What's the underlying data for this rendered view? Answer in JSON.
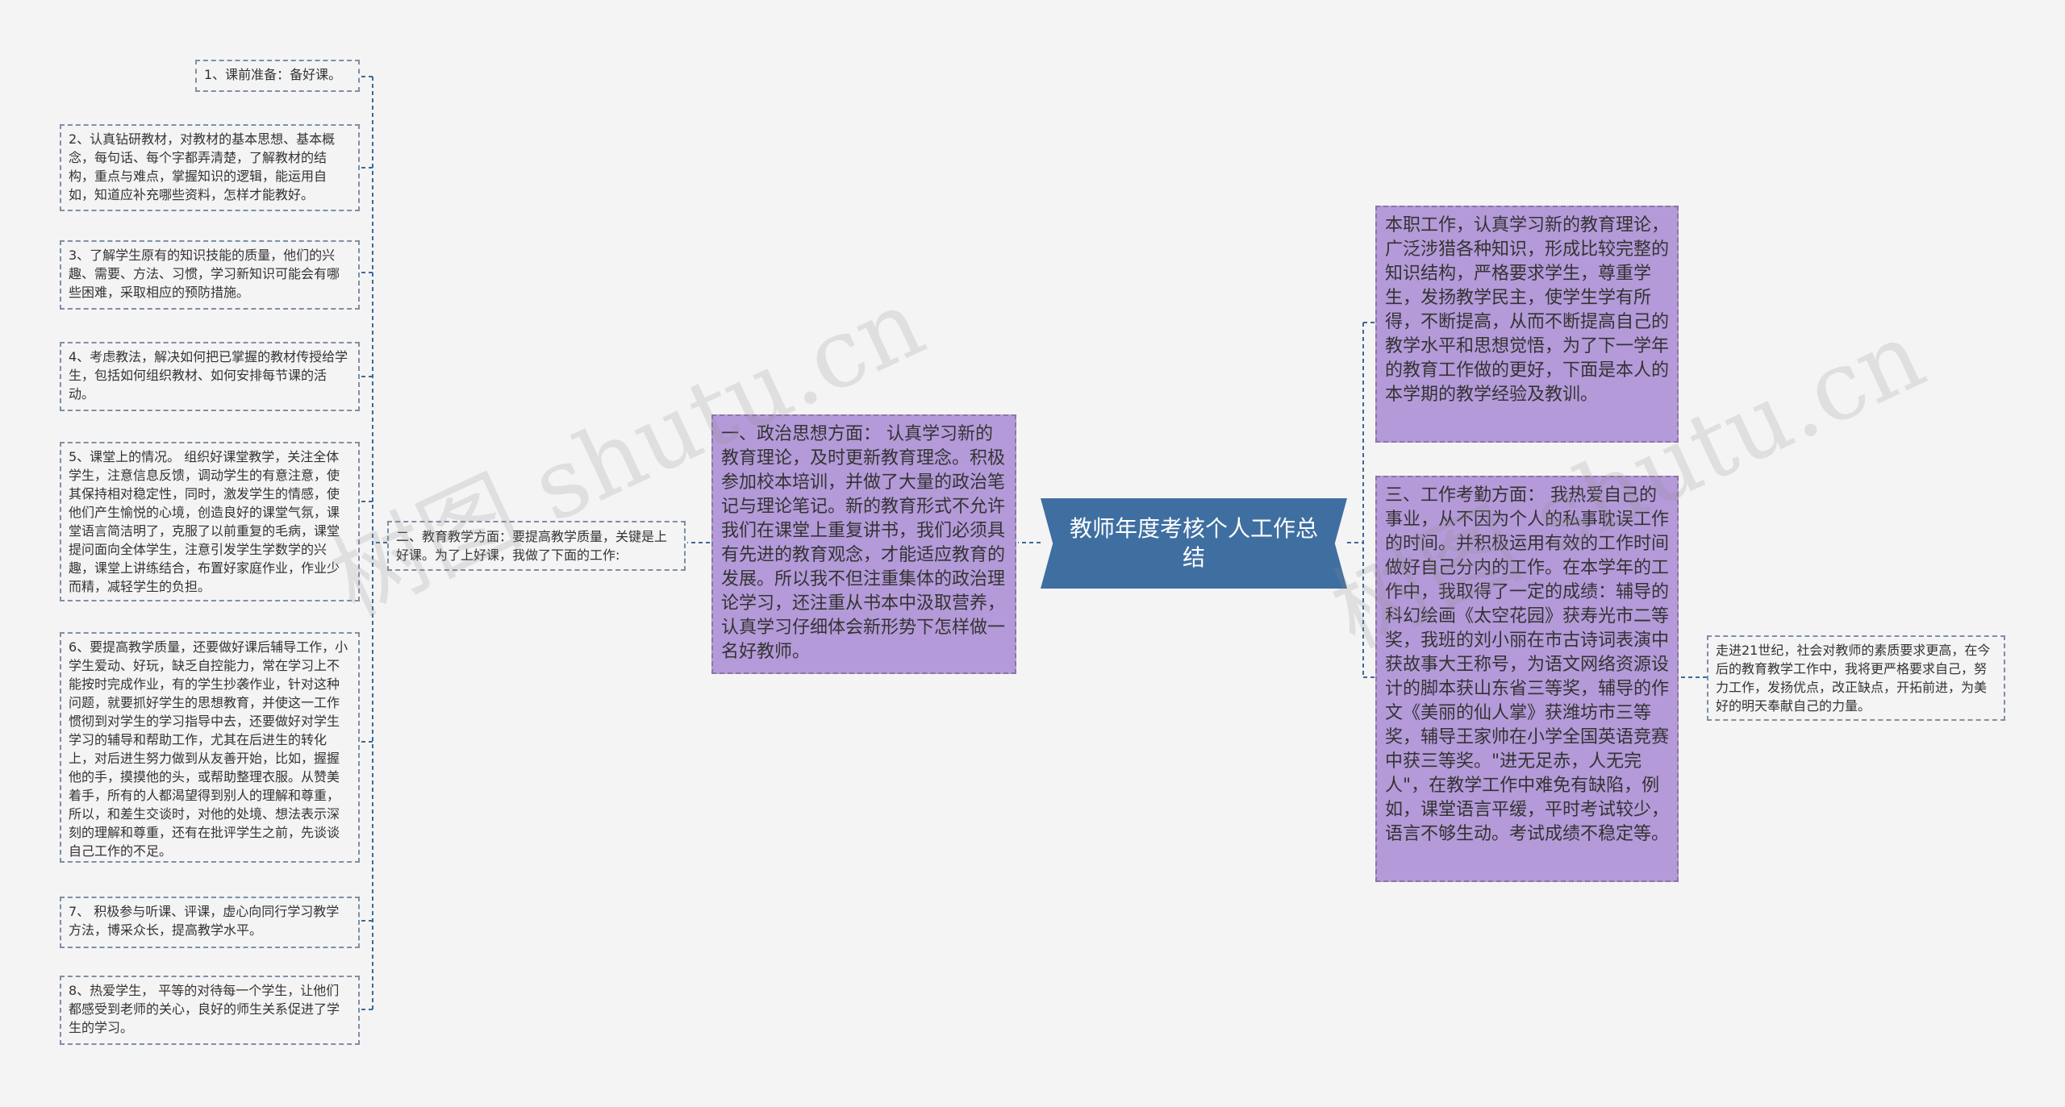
{
  "root": {
    "title": "教师年度考核个人工作总结"
  },
  "left_main": {
    "text": "一、政治思想方面： 认真学习新的教育理论，及时更新教育理念。积极参加校本培训，并做了大量的政治笔记与理论笔记。新的教育形式不允许我们在课堂上重复讲书，我们必须具有先进的教育观念，才能适应教育的发展。所以我不但注重集体的政治理论学习，还注重从书本中汲取营养，认真学习仔细体会新形势下怎样做一名好教师。"
  },
  "left_sub": {
    "text": "二、教育教学方面：要提高教学质量，关键是上好课。为了上好课，我做了下面的工作:"
  },
  "leaves": [
    {
      "text": "1、课前准备：备好课。"
    },
    {
      "text": "2、认真钻研教材，对教材的基本思想、基本概念，每句话、每个字都弄清楚，了解教材的结构，重点与难点，掌握知识的逻辑，能运用自如，知道应补充哪些资料，怎样才能教好。"
    },
    {
      "text": "3、了解学生原有的知识技能的质量，他们的兴趣、需要、方法、习惯，学习新知识可能会有哪些困难，采取相应的预防措施。"
    },
    {
      "text": "4、考虑教法，解决如何把已掌握的教材传授给学生，包括如何组织教材、如何安排每节课的活动。"
    },
    {
      "text": "5、课堂上的情况。 组织好课堂教学，关注全体学生，注意信息反馈，调动学生的有意注意，使其保持相对稳定性，同时，激发学生的情感，使他们产生愉悦的心境，创造良好的课堂气氛，课堂语言简洁明了，克服了以前重复的毛病，课堂提问面向全体学生，注意引发学生学数学的兴趣，课堂上讲练结合，布置好家庭作业，作业少而精，减轻学生的负担。"
    },
    {
      "text": "6、要提高教学质量，还要做好课后辅导工作，小学生爱动、好玩，缺乏自控能力，常在学习上不能按时完成作业，有的学生抄袭作业，针对这种问题，就要抓好学生的思想教育，并使这一工作惯彻到对学生的学习指导中去，还要做好对学生学习的辅导和帮助工作，尤其在后进生的转化上，对后进生努力做到从友善开始，比如，握握他的手，摸摸他的头，或帮助整理衣服。从赞美着手，所有的人都渴望得到别人的理解和尊重，所以，和差生交谈时，对他的处境、想法表示深刻的理解和尊重，还有在批评学生之前，先谈谈自己工作的不足。"
    },
    {
      "text": "7、 积极参与听课、评课，虚心向同行学习教学方法，博采众长，提高教学水平。"
    },
    {
      "text": "8、热爱学生， 平等的对待每一个学生，让他们都感受到老师的关心，良好的师生关系促进了学生的学习。"
    }
  ],
  "right_top": {
    "text": "本职工作，认真学习新的教育理论，广泛涉猎各种知识，形成比较完整的知识结构，严格要求学生，尊重学生，发扬教学民主，使学生学有所得，不断提高，从而不断提高自己的教学水平和思想觉悟，为了下一学年的教育工作做的更好，下面是本人的本学期的教学经验及教训。"
  },
  "right_bottom": {
    "text": "三、工作考勤方面： 我热爱自己的事业，从不因为个人的私事耽误工作的时间。并积极运用有效的工作时间做好自己分内的工作。在本学年的工作中，我取得了一定的成绩：辅导的科幻绘画《太空花园》获寿光市二等奖，我班的刘小丽在市古诗词表演中获故事大王称号，为语文网络资源设计的脚本获山东省三等奖，辅导的作文《美丽的仙人掌》获潍坊市三等奖，辅导王家帅在小学全国英语竞赛中获三等奖。\"进无足赤，人无完人\"，在教学工作中难免有缺陷，例如，课堂语言平缓，平时考试较少，语言不够生动。考试成绩不稳定等。"
  },
  "right_leaf": {
    "text": "走进21世纪，社会对教师的素质要求更高，在今后的教育教学工作中，我将更严格要求自己，努力工作，发扬优点，改正缺点，开拓前进，为美好的明天奉献自己的力量。"
  },
  "watermarks": [
    "树图 shutu.cn",
    "树图 shutu.cn"
  ],
  "colors": {
    "root": "#3f6fa1",
    "purple": "#b49ad8",
    "connector": "#3d6a99",
    "background": "#f4f4f4"
  }
}
